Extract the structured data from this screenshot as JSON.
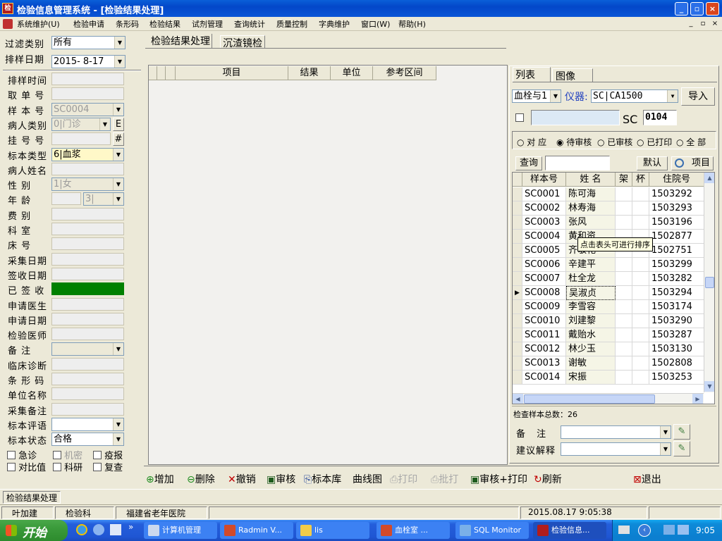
{
  "window": {
    "title": "检验信息管理系统 - [检验结果处理]",
    "min": "_",
    "restore": "▫",
    "close": "×"
  },
  "menu": {
    "items": [
      "系统维护(U)",
      "检验申请",
      "条形码",
      "检验结果",
      "试剂管理",
      "查询统计",
      "质量控制",
      "字典维护",
      "窗口(W)",
      "帮助(H)"
    ],
    "mdi_buttons": [
      "_",
      "▫",
      "×"
    ]
  },
  "filter": {
    "type_label": "过滤类别",
    "type_value": "所有",
    "date_label": "排样日期",
    "date_value": "2015- 8-17"
  },
  "form": {
    "fields": [
      "排样时间",
      "取 单 号",
      "样 本 号",
      "病人类别",
      "挂 号 号",
      "标本类型",
      "病人姓名",
      "性 别",
      "年 龄",
      "费 别",
      "科 室",
      "床 号",
      "采集日期",
      "签收日期",
      "已 签 收",
      "申请医生",
      "申请日期",
      "检验医师",
      "备 注",
      "临床诊断",
      "条 形 码",
      "单位名称",
      "采集备注",
      "标本评语",
      "标本状态"
    ],
    "sample_no": "SC0004",
    "patient_type": "0|门诊",
    "patient_type_btn": "E",
    "reg_btn": "#",
    "specimen_type": "6|血浆",
    "sex": "1|女",
    "age_unit": "3|",
    "status": "合格",
    "checkboxes": [
      "急诊",
      "机密",
      "疫报",
      "对比值",
      "科研",
      "复查"
    ]
  },
  "tabs": {
    "main": [
      "检验结果处理",
      "沉渣镜检"
    ],
    "right": [
      "列表",
      "图像"
    ]
  },
  "result_grid": {
    "headers": [
      "项目",
      "结果",
      "单位",
      "参考区间"
    ]
  },
  "right": {
    "dept_select": "血栓与1",
    "instrument_label": "仪器:",
    "instrument_value": "SC|CA1500",
    "import_btn": "导入",
    "prefix": "SC",
    "number": "0104",
    "radios": [
      "对 应",
      "待审核",
      "已审核",
      "已打印",
      "全 部"
    ],
    "query_btn": "查询",
    "default_btn": "默认",
    "item_btn": "项目",
    "tooltip": "点击表头可进行排序",
    "total_label": "检查样本总数：26",
    "remark_label": "备 注",
    "advice_label": "建议解释"
  },
  "samples": {
    "headers": [
      "样本号",
      "姓 名",
      "架",
      "杯",
      "住院号"
    ],
    "rows": [
      [
        "SC0001",
        "陈可海",
        "",
        "",
        "1503292"
      ],
      [
        "SC0002",
        "林寿海",
        "",
        "",
        "1503293"
      ],
      [
        "SC0003",
        "张风",
        "",
        "",
        "1503196"
      ],
      [
        "SC0004",
        "黄和资",
        "",
        "",
        "1502877"
      ],
      [
        "SC0005",
        "齐敬花",
        "",
        "",
        "1502751"
      ],
      [
        "SC0006",
        "辛建平",
        "",
        "",
        "1503299"
      ],
      [
        "SC0007",
        "杜全龙",
        "",
        "",
        "1503282"
      ],
      [
        "SC0008",
        "吴淑贞",
        "",
        "",
        "1503294"
      ],
      [
        "SC0009",
        "李雪容",
        "",
        "",
        "1503174"
      ],
      [
        "SC0010",
        "刘建黎",
        "",
        "",
        "1503290"
      ],
      [
        "SC0011",
        "戴贻水",
        "",
        "",
        "1503287"
      ],
      [
        "SC0012",
        "林少玉",
        "",
        "",
        "1503130"
      ],
      [
        "SC0013",
        "谢敏",
        "",
        "",
        "1502808"
      ],
      [
        "SC0014",
        "宋振",
        "",
        "",
        "1503253"
      ]
    ],
    "selected_index": 7
  },
  "toolbar": [
    "增加",
    "删除",
    "撤销",
    "审核",
    "标本库",
    "曲线图",
    "打印",
    "批打",
    "审核+打印",
    "刷新",
    "退出"
  ],
  "statusbar": {
    "window_tab": "检验结果处理",
    "user": "叶加建",
    "dept": "检验科",
    "hospital": "福建省老年医院",
    "datetime": "2015.08.17 9:05:38"
  },
  "taskbar": {
    "start": "开始",
    "tasks": [
      "计算机管理",
      "Radmin V...",
      "lis",
      "血栓室 ...",
      "SQL Monitor",
      "检验信息..."
    ],
    "clock": "9:05"
  },
  "colors": {
    "signed_green": "#008000",
    "title_blue": "#0a5fd8",
    "instrument_label": "#1f3fbf"
  }
}
